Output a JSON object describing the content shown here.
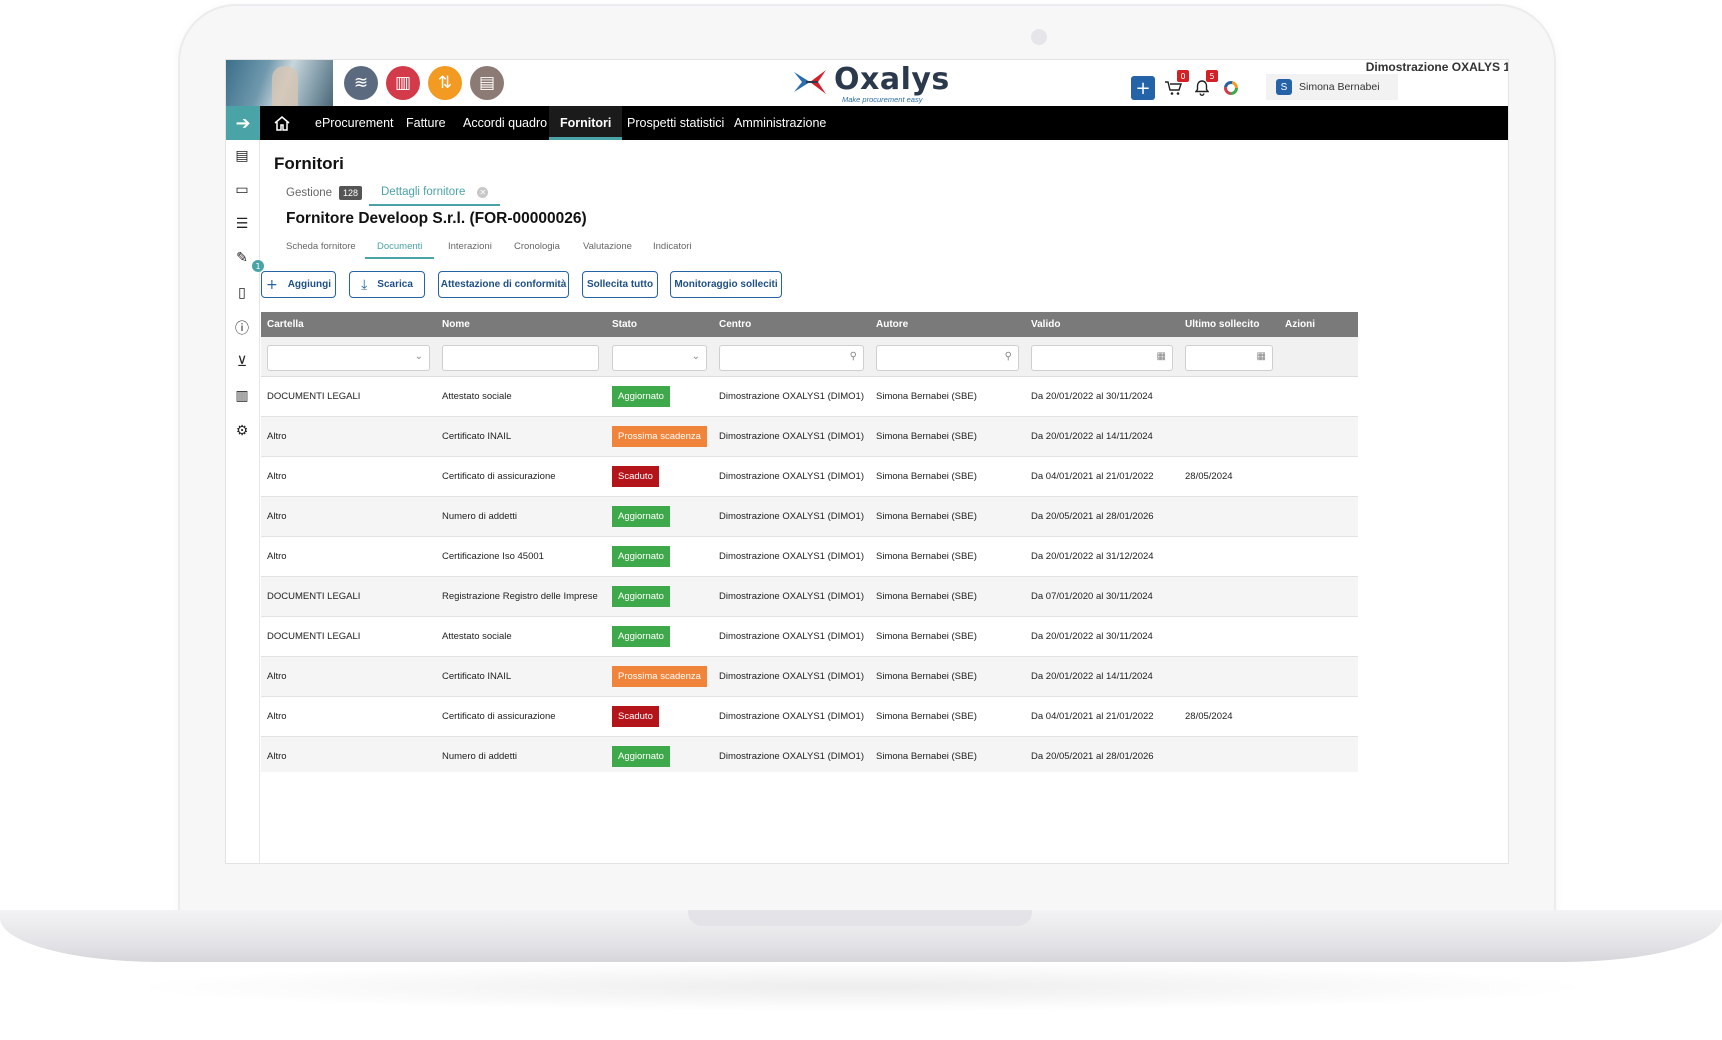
{
  "app": {
    "logo_text": "Oxalys",
    "logo_tagline": "Make procurement easy",
    "org_name": "Dimostrazione OXALYS 1",
    "user_initial": "S",
    "user_name": "Simona Bernabei",
    "cart_count": "0",
    "notif_count": "5",
    "accent_color": "#4aa3a6",
    "primary_color": "#2563a8"
  },
  "app_icons": [
    {
      "name": "layers-icon",
      "color": "#5b6a7e",
      "glyph": "≋"
    },
    {
      "name": "chart-icon",
      "color": "#d33a4a",
      "glyph": "▥"
    },
    {
      "name": "workflow-icon",
      "color": "#f29a22",
      "glyph": "⇅"
    },
    {
      "name": "catalog-icon",
      "color": "#8c7b74",
      "glyph": "▤"
    }
  ],
  "nav": {
    "items": [
      "eProcurement",
      "Fatture",
      "Accordi quadro",
      "Fornitori",
      "Prospetti statistici",
      "Amministrazione"
    ],
    "active": "Fornitori"
  },
  "page": {
    "title": "Fornitori",
    "tabs": [
      {
        "label": "Gestione",
        "count": "128"
      },
      {
        "label": "Dettagli fornitore"
      }
    ],
    "supplier_title": "Fornitore Develoop S.r.l. (FOR-00000026)",
    "subtabs": [
      "Scheda fornitore",
      "Documenti",
      "Interazioni",
      "Cronologia",
      "Valutazione",
      "Indicatori"
    ],
    "active_subtab": "Documenti"
  },
  "actions": {
    "add": "Aggiungi",
    "download": "Scarica",
    "attestation": "Attestazione di conformità",
    "remind_all": "Sollecita tutto",
    "monitor": "Monitoraggio solleciti"
  },
  "table": {
    "columns": [
      "Cartella",
      "Nome",
      "Stato",
      "Centro",
      "Autore",
      "Valido",
      "Ultimo sollecito",
      "Azioni"
    ],
    "rows": [
      {
        "cartella": "DOCUMENTI LEGALI",
        "nome": "Attestato sociale",
        "stato": "Aggiornato",
        "status": "green",
        "centro": "Dimostrazione OXALYS1 (DIMO1)",
        "autore": "Simona Bernabei (SBE)",
        "valido": "Da 20/01/2022 al 30/11/2024",
        "sollecito": ""
      },
      {
        "cartella": "Altro",
        "nome": "Certificato INAIL",
        "stato": "Prossima scadenza",
        "status": "orange",
        "centro": "Dimostrazione OXALYS1 (DIMO1)",
        "autore": "Simona Bernabei (SBE)",
        "valido": "Da 20/01/2022 al 14/11/2024",
        "sollecito": ""
      },
      {
        "cartella": "Altro",
        "nome": "Certificato di assicurazione",
        "stato": "Scaduto",
        "status": "red",
        "centro": "Dimostrazione OXALYS1 (DIMO1)",
        "autore": "Simona Bernabei (SBE)",
        "valido": "Da 04/01/2021 al 21/01/2022",
        "sollecito": "28/05/2024"
      },
      {
        "cartella": "Altro",
        "nome": "Numero di addetti",
        "stato": "Aggiornato",
        "status": "green",
        "centro": "Dimostrazione OXALYS1 (DIMO1)",
        "autore": "Simona Bernabei (SBE)",
        "valido": "Da 20/05/2021 al 28/01/2026",
        "sollecito": ""
      },
      {
        "cartella": "Altro",
        "nome": "Certificazione Iso 45001",
        "stato": "Aggiornato",
        "status": "green",
        "centro": "Dimostrazione OXALYS1 (DIMO1)",
        "autore": "Simona Bernabei (SBE)",
        "valido": "Da 20/01/2022 al 31/12/2024",
        "sollecito": ""
      },
      {
        "cartella": "DOCUMENTI LEGALI",
        "nome": "Registrazione Registro delle Imprese",
        "stato": "Aggiornato",
        "status": "green",
        "centro": "Dimostrazione OXALYS1 (DIMO1)",
        "autore": "Simona Bernabei (SBE)",
        "valido": "Da 07/01/2020 al 30/11/2024",
        "sollecito": ""
      },
      {
        "cartella": "DOCUMENTI LEGALI",
        "nome": "Attestato sociale",
        "stato": "Aggiornato",
        "status": "green",
        "centro": "Dimostrazione OXALYS1 (DIMO1)",
        "autore": "Simona Bernabei (SBE)",
        "valido": "Da 20/01/2022 al 30/11/2024",
        "sollecito": ""
      },
      {
        "cartella": "Altro",
        "nome": "Certificato INAIL",
        "stato": "Prossima scadenza",
        "status": "orange",
        "centro": "Dimostrazione OXALYS1 (DIMO1)",
        "autore": "Simona Bernabei (SBE)",
        "valido": "Da 20/01/2022 al 14/11/2024",
        "sollecito": ""
      },
      {
        "cartella": "Altro",
        "nome": "Certificato di assicurazione",
        "stato": "Scaduto",
        "status": "red",
        "centro": "Dimostrazione OXALYS1 (DIMO1)",
        "autore": "Simona Bernabei (SBE)",
        "valido": "Da 04/01/2021 al 21/01/2022",
        "sollecito": "28/05/2024"
      },
      {
        "cartella": "Altro",
        "nome": "Numero di addetti",
        "stato": "Aggiornato",
        "status": "green",
        "centro": "Dimostrazione OXALYS1 (DIMO1)",
        "autore": "Simona Bernabei (SBE)",
        "valido": "Da 20/05/2021 al 28/01/2026",
        "sollecito": ""
      }
    ]
  }
}
